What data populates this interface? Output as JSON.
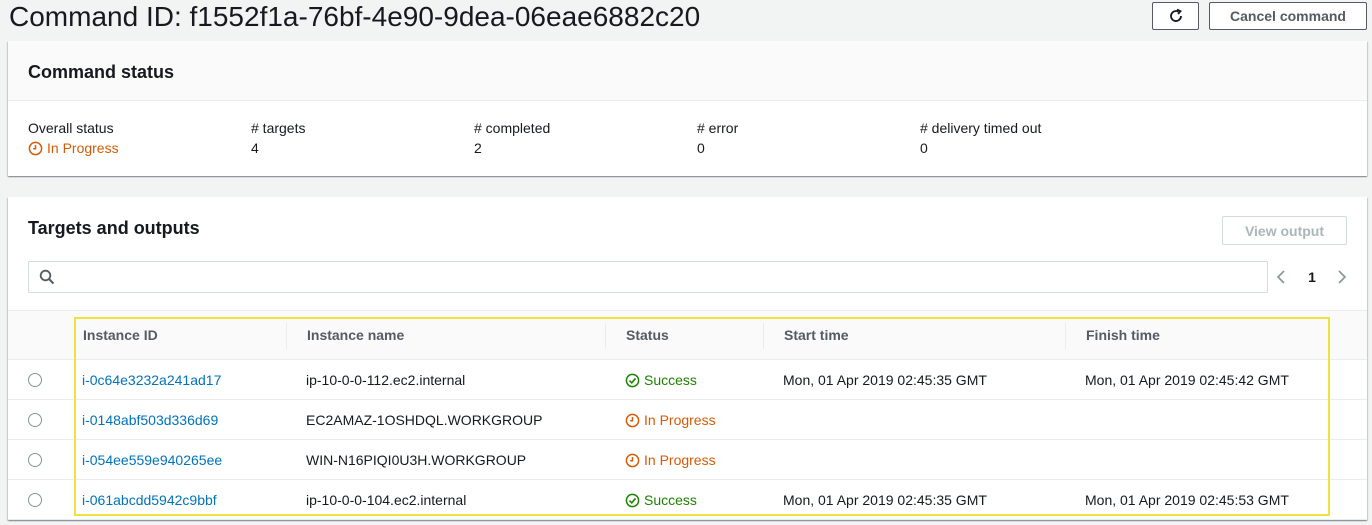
{
  "page": {
    "title": "Command ID: f1552f1a-76bf-4e90-9dea-06eae6882c20",
    "cancel_label": "Cancel command"
  },
  "status_panel": {
    "heading": "Command status",
    "stats": [
      {
        "label": "Overall status",
        "value": "In Progress"
      },
      {
        "label": "# targets",
        "value": "4"
      },
      {
        "label": "# completed",
        "value": "2"
      },
      {
        "label": "# error",
        "value": "0"
      },
      {
        "label": "# delivery timed out",
        "value": "0"
      }
    ]
  },
  "targets_panel": {
    "heading": "Targets and outputs",
    "view_output_label": "View output",
    "search_placeholder": "",
    "current_page": "1",
    "columns": [
      "Instance ID",
      "Instance name",
      "Status",
      "Start time",
      "Finish time"
    ],
    "rows": [
      {
        "instance_id": "i-0c64e3232a241ad17",
        "instance_name": "ip-10-0-0-112.ec2.internal",
        "status": "Success",
        "start_time": "Mon, 01 Apr 2019 02:45:35 GMT",
        "finish_time": "Mon, 01 Apr 2019 02:45:42 GMT"
      },
      {
        "instance_id": "i-0148abf503d336d69",
        "instance_name": "EC2AMAZ-1OSHDQL.WORKGROUP",
        "status": "In Progress",
        "start_time": "",
        "finish_time": ""
      },
      {
        "instance_id": "i-054ee559e940265ee",
        "instance_name": "WIN-N16PIQI0U3H.WORKGROUP",
        "status": "In Progress",
        "start_time": "",
        "finish_time": ""
      },
      {
        "instance_id": "i-061abcdd5942c9bbf",
        "instance_name": "ip-10-0-0-104.ec2.internal",
        "status": "Success",
        "start_time": "Mon, 01 Apr 2019 02:45:35 GMT",
        "finish_time": "Mon, 01 Apr 2019 02:45:53 GMT"
      }
    ]
  },
  "colors": {
    "link": "#0073bb",
    "success": "#1d8102",
    "in_progress": "#d45b07",
    "highlight": "#f0e23e"
  }
}
